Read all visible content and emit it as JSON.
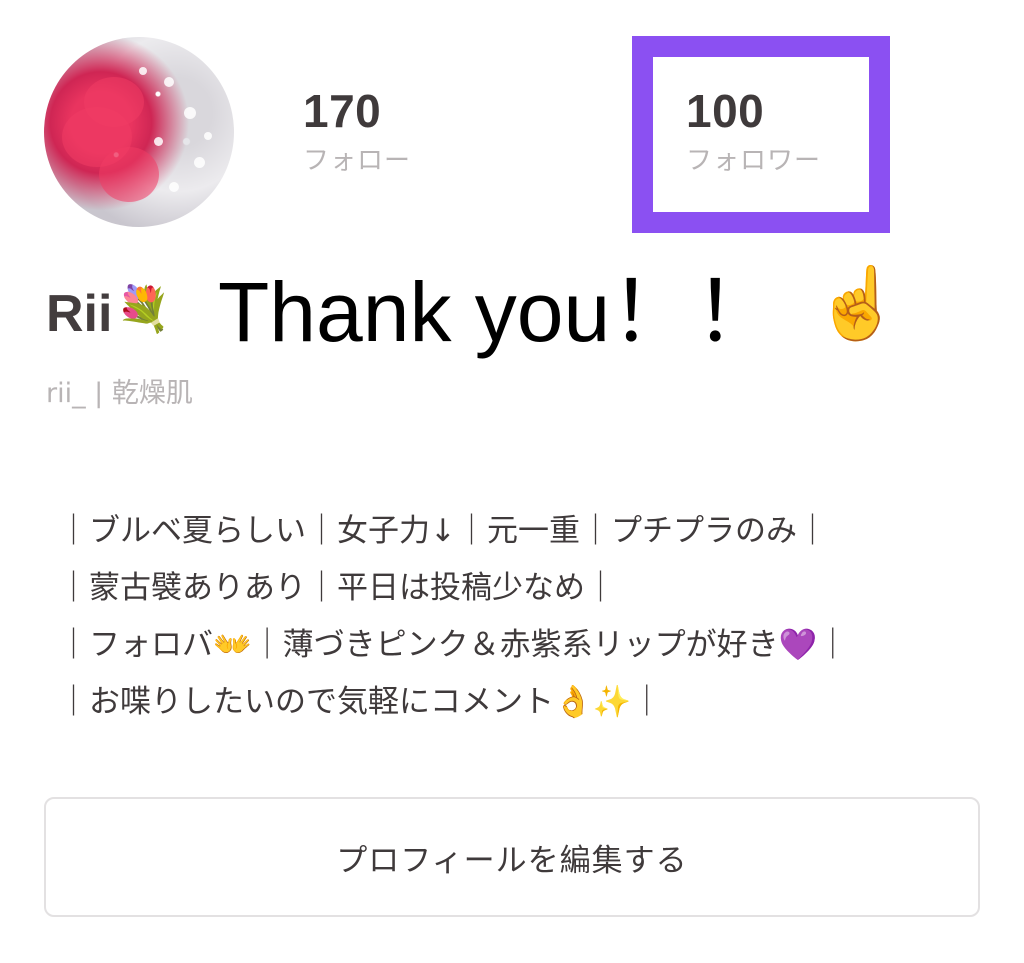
{
  "profile": {
    "avatar_icon": "flower-photo-avatar",
    "display_name": "Rii",
    "name_emoji": "💐",
    "handle": "rii_ | 乾燥肌"
  },
  "stats": {
    "following": {
      "count": "170",
      "label": "フォロー"
    },
    "followers": {
      "count": "100",
      "label": "フォロワー"
    }
  },
  "highlight": {
    "color": "#8b50f2"
  },
  "overlay": {
    "text": "Thank you！！",
    "emoji": "☝️"
  },
  "bio": {
    "lines": [
      "｜ブルベ夏らしい｜女子力↓｜元一重｜プチプラのみ｜",
      "｜蒙古襞ありあり｜平日は投稿少なめ｜",
      "｜フォロバ👐｜薄づきピンク＆赤紫系リップが好き💜｜",
      "｜お喋りしたいので気軽にコメント👌✨｜"
    ]
  },
  "edit_button": {
    "label": "プロフィールを編集する"
  }
}
